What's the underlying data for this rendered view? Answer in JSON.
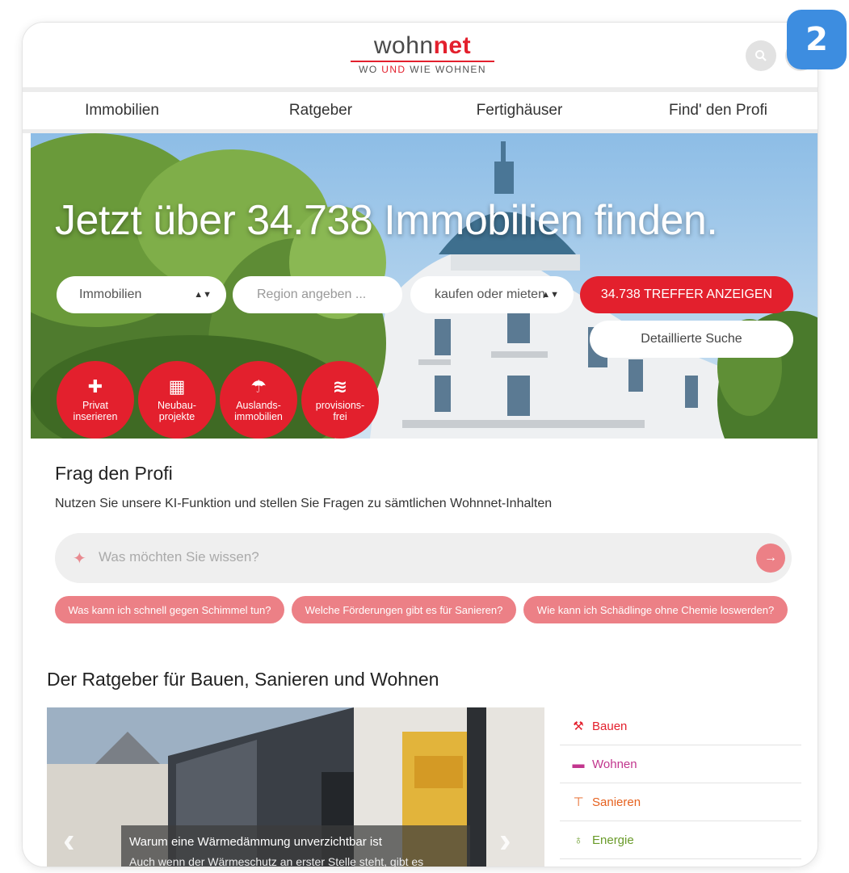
{
  "badge": "2",
  "header": {
    "logo_part1": "wohn",
    "logo_part2": "net",
    "logo_sub_a": "WO ",
    "logo_sub_b": "UND",
    "logo_sub_c": " WIE WOHNEN"
  },
  "nav": {
    "items": [
      "Immobilien",
      "Ratgeber",
      "Fertighäuser",
      "Find' den Profi"
    ]
  },
  "hero": {
    "title": "Jetzt über 34.738 Immobilien finden.",
    "type_select": "Immobilien",
    "region_placeholder": "Region angeben ...",
    "mode_select": "kaufen oder mieten",
    "submit_label": "34.738 TREFFER ANZEIGEN",
    "detail_search": "Detaillierte Suche",
    "quick": [
      {
        "line1": "Privat",
        "line2": "inserieren",
        "icon": "plus-icon"
      },
      {
        "line1": "Neubau-",
        "line2": "projekte",
        "icon": "building-icon"
      },
      {
        "line1": "Auslands-",
        "line2": "immobilien",
        "icon": "beach-umbrella-icon"
      },
      {
        "line1": "provisions-",
        "line2": "frei",
        "icon": "coins-icon"
      }
    ]
  },
  "profi": {
    "title": "Frag den Profi",
    "subtitle": "Nutzen Sie unsere KI-Funktion und stellen Sie Fragen zu sämtlichen Wohnnet-Inhalten",
    "placeholder": "Was möchten Sie wissen?",
    "chips": [
      "Was kann ich schnell gegen Schimmel tun?",
      "Welche Förderungen gibt es für Sanieren?",
      "Wie kann ich Schädlinge ohne Chemie loswerden?"
    ]
  },
  "ratgeber": {
    "title": "Der Ratgeber für Bauen, Sanieren und Wohnen",
    "caption_title": "Warum eine Wärmedämmung unverzichtbar ist",
    "caption_sub": "Auch wenn der Wärmeschutz an erster Stelle steht, gibt es",
    "categories": [
      {
        "label": "Bauen",
        "color": "#e3202d",
        "icon": "hammer-icon"
      },
      {
        "label": "Wohnen",
        "color": "#c2368e",
        "icon": "sofa-icon"
      },
      {
        "label": "Sanieren",
        "color": "#e6611e",
        "icon": "paint-roller-icon"
      },
      {
        "label": "Energie",
        "color": "#6a9b2a",
        "icon": "lightbulb-icon"
      }
    ]
  },
  "colors": {
    "brand_red": "#e3202d",
    "chip_pink": "#ec8086",
    "badge_blue": "#3d8de0"
  }
}
